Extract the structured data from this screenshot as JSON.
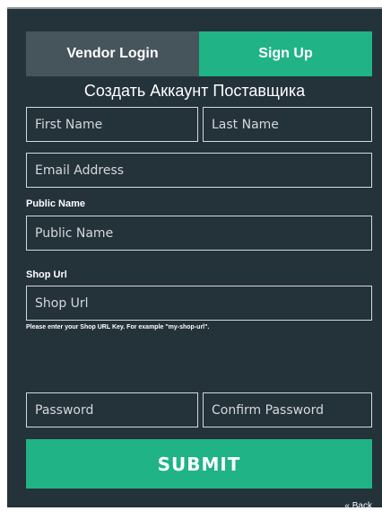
{
  "tabs": {
    "login_label": "Vendor Login",
    "signup_label": "Sign Up"
  },
  "form": {
    "heading": "Создать Аккаунт Поставщика",
    "first_name_placeholder": "First Name",
    "last_name_placeholder": "Last Name",
    "email_placeholder": "Email Address",
    "public_name_label": "Public Name",
    "public_name_placeholder": "Public Name",
    "shop_url_label": "Shop Url",
    "shop_url_placeholder": "Shop Url",
    "shop_url_hint": "Please enter your Shop URL Key. For example \"my-shop-url\".",
    "password_placeholder": "Password",
    "confirm_password_placeholder": "Confirm Password",
    "submit_label": "SUBMIT",
    "back_label": "« Back"
  },
  "colors": {
    "panel_bg": "#24323a",
    "accent": "#1fb386",
    "inactive_tab": "#46545b"
  }
}
